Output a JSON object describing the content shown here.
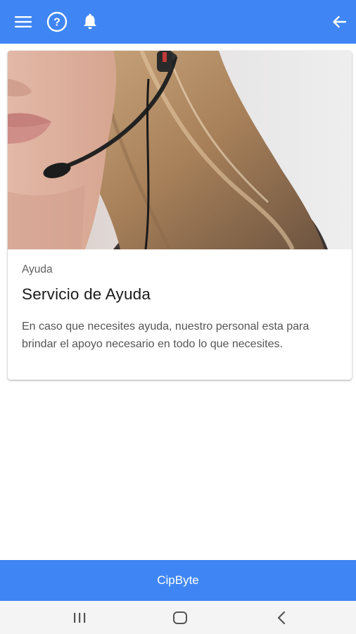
{
  "header": {
    "icons": [
      "menu-icon",
      "help-icon",
      "bell-icon",
      "back-arrow-icon"
    ]
  },
  "card": {
    "image": "support-agent-headset-photo",
    "overline": "Ayuda",
    "title": "Servicio de Ayuda",
    "body": "En caso que necesites ayuda, nuestro personal esta para brindar el apoyo necesario en todo lo que necesites."
  },
  "footer": {
    "label": "CipByte"
  },
  "system_nav": {
    "icons": [
      "recent-apps-icon",
      "home-icon",
      "back-icon"
    ]
  },
  "colors": {
    "primary": "#3f86f4",
    "surface": "#ffffff",
    "nav_bar": "#f4f4f4"
  }
}
